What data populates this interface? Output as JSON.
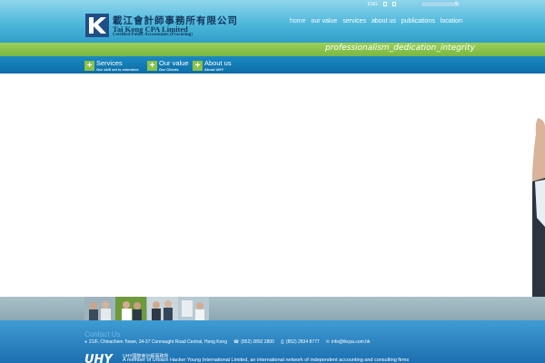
{
  "header": {
    "logo": {
      "chinese_name": "載江會計師事務所有限公司",
      "english_name": "Tai Kong CPA Limited",
      "subtitle": "Certified Public Accountants (Practising)"
    },
    "utilities": {
      "language_label": "ENG",
      "icons": [
        "print-icon",
        "bookmark-icon"
      ],
      "search_icon": "search-icon"
    },
    "nav": [
      {
        "label": "home",
        "active": true
      },
      {
        "label": "our value",
        "active": false
      },
      {
        "label": "services",
        "active": false
      },
      {
        "label": "about us",
        "active": false
      },
      {
        "label": "publications",
        "active": false
      },
      {
        "label": "location",
        "active": false
      }
    ]
  },
  "tagline": "professionalism_dedication_integrity",
  "subnav": [
    {
      "title": "Services",
      "desc": "Our skill set is extensive"
    },
    {
      "title": "Our value",
      "desc": "Our Clients"
    },
    {
      "title": "About us",
      "desc": "About UHY"
    }
  ],
  "footer": {
    "contact_title": "Contact Us",
    "address": "21/F, Chinachem Tower, 34-37 Connaught Road Central, Hong Kong",
    "phone": "(852) 2892 2800",
    "fax": "(852) 2834 8777",
    "email": "info@tkcpa.com.hk",
    "uhy_logo": "UHY",
    "uhy_chinese": "UHY國際會計師事務所",
    "uhy_member": "A member of Urbach Hacker Young International Limited, an international network of independent accounting and consulting firms"
  },
  "colors": {
    "header_blue": "#4fb8dc",
    "green_band": "#8ac24a",
    "subnav_blue": "#0d6ea8",
    "footer_blue": "#1c6fb0",
    "logo_navy": "#12365c"
  }
}
